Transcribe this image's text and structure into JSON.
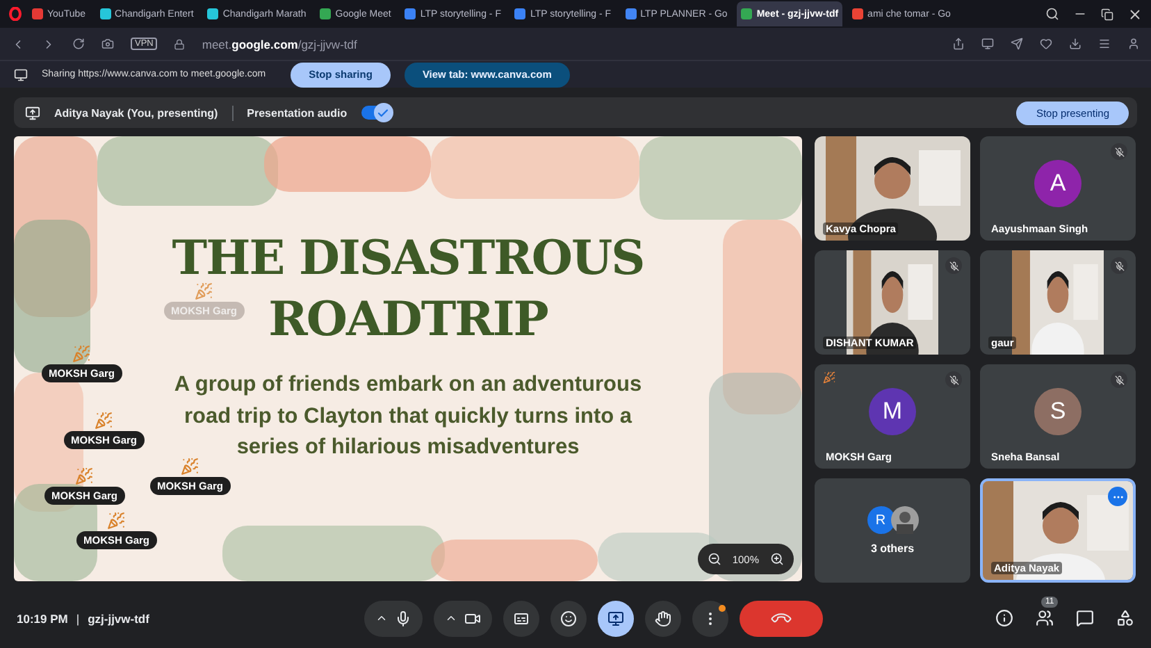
{
  "browser": {
    "tabs": [
      {
        "label": "YouTube",
        "selected": false,
        "color": "#e53935"
      },
      {
        "label": "Chandigarh Entert",
        "selected": false,
        "color": "#26c6da"
      },
      {
        "label": "Chandigarh Marath",
        "selected": false,
        "color": "#26c6da"
      },
      {
        "label": "Google Meet",
        "selected": false,
        "color": "#34a853"
      },
      {
        "label": "LTP storytelling - F",
        "selected": false,
        "color": "#3b82f6"
      },
      {
        "label": "LTP storytelling - F",
        "selected": false,
        "color": "#3b82f6"
      },
      {
        "label": "LTP PLANNER - Go",
        "selected": false,
        "color": "#4285f4"
      },
      {
        "label": "Meet - gzj-jjvw-tdf",
        "selected": true,
        "color": "#34a853"
      },
      {
        "label": "ami che tomar - Go",
        "selected": false,
        "color": "#ea4335"
      }
    ],
    "vpn": "VPN",
    "address": "meet.**google.com**/gzj-jjvw-tdf",
    "sharing_bar": {
      "message": "Sharing https://www.canva.com to meet.google.com",
      "stop_button": "Stop sharing",
      "view_button": "View tab: www.canva.com"
    }
  },
  "presenting_bar": {
    "presenter": "Aditya Nayak (You, presenting)",
    "audio_label": "Presentation audio",
    "audio_on": true,
    "stop_button": "Stop presenting"
  },
  "slide": {
    "title_lines": [
      "THE DISASTROUS",
      "ROADTRIP"
    ],
    "subtitle_lines": [
      "A group of friends embark on an adventurous",
      "road trip to Clayton that quickly turns into a",
      "series of hilarious misadventures"
    ],
    "zoom": "100%",
    "reactions": [
      {
        "name": "MOKSH Garg",
        "faded": true
      },
      {
        "name": "MOKSH Garg",
        "faded": false
      },
      {
        "name": "MOKSH Garg",
        "faded": false
      },
      {
        "name": "MOKSH Garg",
        "faded": false
      },
      {
        "name": "MOKSH Garg",
        "faded": false
      },
      {
        "name": "MOKSH Garg",
        "faded": false
      }
    ]
  },
  "tiles": [
    {
      "kind": "video",
      "name": "Kavya Chopra",
      "active": false
    },
    {
      "kind": "avatar",
      "name": "Aayushmaan Singh",
      "initial": "A",
      "color": "#8e24aa",
      "muted": true,
      "active": false
    },
    {
      "kind": "portrait",
      "name": "DISHANT KUMAR",
      "muted": true,
      "active": false
    },
    {
      "kind": "portrait",
      "name": "gaur",
      "muted": true,
      "active": false
    },
    {
      "kind": "avatar",
      "name": "MOKSH Garg",
      "initial": "M",
      "color": "#5e35b1",
      "muted": true,
      "reacting": true,
      "active": false
    },
    {
      "kind": "avatar",
      "name": "Sneha Bansal",
      "initial": "S",
      "color": "#8d6e63",
      "muted": true,
      "active": false
    },
    {
      "kind": "others",
      "name": "3 others",
      "initial": "R",
      "color": "#1a73e8",
      "active": false
    },
    {
      "kind": "video",
      "name": "Aditya Nayak",
      "active": true
    }
  ],
  "bottom_bar": {
    "time": "10:19 PM",
    "separator": "|",
    "meeting_code": "gzj-jjvw-tdf",
    "people_count": "11",
    "controls": [
      {
        "kind": "mic",
        "selected": false
      },
      {
        "kind": "camera",
        "selected": false
      },
      {
        "kind": "captions",
        "selected": false
      },
      {
        "kind": "emoji",
        "selected": false
      },
      {
        "kind": "present",
        "selected": true
      },
      {
        "kind": "hand",
        "selected": false
      },
      {
        "kind": "more",
        "selected": false
      },
      {
        "kind": "leave",
        "selected": false
      }
    ]
  }
}
